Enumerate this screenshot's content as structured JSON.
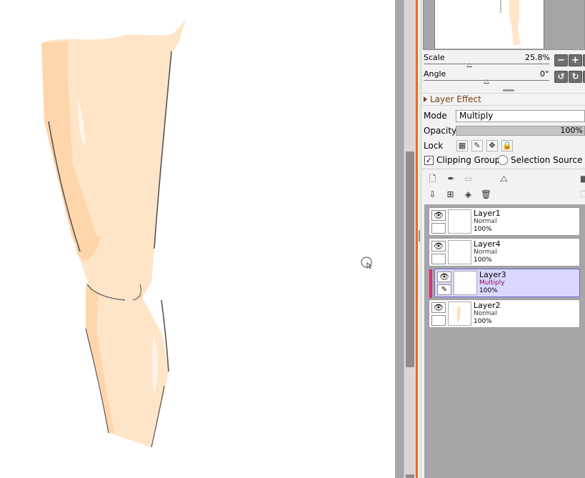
{
  "navigator": {
    "scale_label": "Scale",
    "scale_value": "25.8%",
    "scale_fraction": 0.258,
    "angle_label": "Angle",
    "angle_value": "0°",
    "zoom_out_icon": "minus-icon",
    "zoom_in_icon": "plus-icon",
    "rotate_ccw_icon": "rotate-ccw-icon",
    "rotate_cw_icon": "rotate-cw-icon"
  },
  "layer_effect": {
    "header": "Layer Effect",
    "mode_label": "Mode",
    "mode_value": "Multiply",
    "opacity_label": "Opacity",
    "opacity_value": "100%",
    "opacity_fraction": 1.0,
    "lock_label": "Lock",
    "clipping_group_label": "Clipping Group",
    "clipping_group_checked": true,
    "selection_source_label": "Selection Source",
    "selection_source_checked": false,
    "check_mark": "✓"
  },
  "layers": [
    {
      "name": "Layer1",
      "blend": "Normal",
      "opacity": "100%",
      "visible": true,
      "selected": false,
      "clipped": false
    },
    {
      "name": "Layer4",
      "blend": "Normal",
      "opacity": "100%",
      "visible": true,
      "selected": false,
      "clipped": false
    },
    {
      "name": "Layer3",
      "blend": "Multiply",
      "opacity": "100%",
      "visible": true,
      "selected": true,
      "clipped": true
    },
    {
      "name": "Layer2",
      "blend": "Normal",
      "opacity": "100%",
      "visible": true,
      "selected": false,
      "clipped": false
    }
  ],
  "colors": {
    "accent": "#f06a1b",
    "selected_layer": "#d8d8ff",
    "clip_bar": "#d0336b",
    "skin": "#ffe4c6",
    "skin_shadow": "#ffd3a6"
  }
}
